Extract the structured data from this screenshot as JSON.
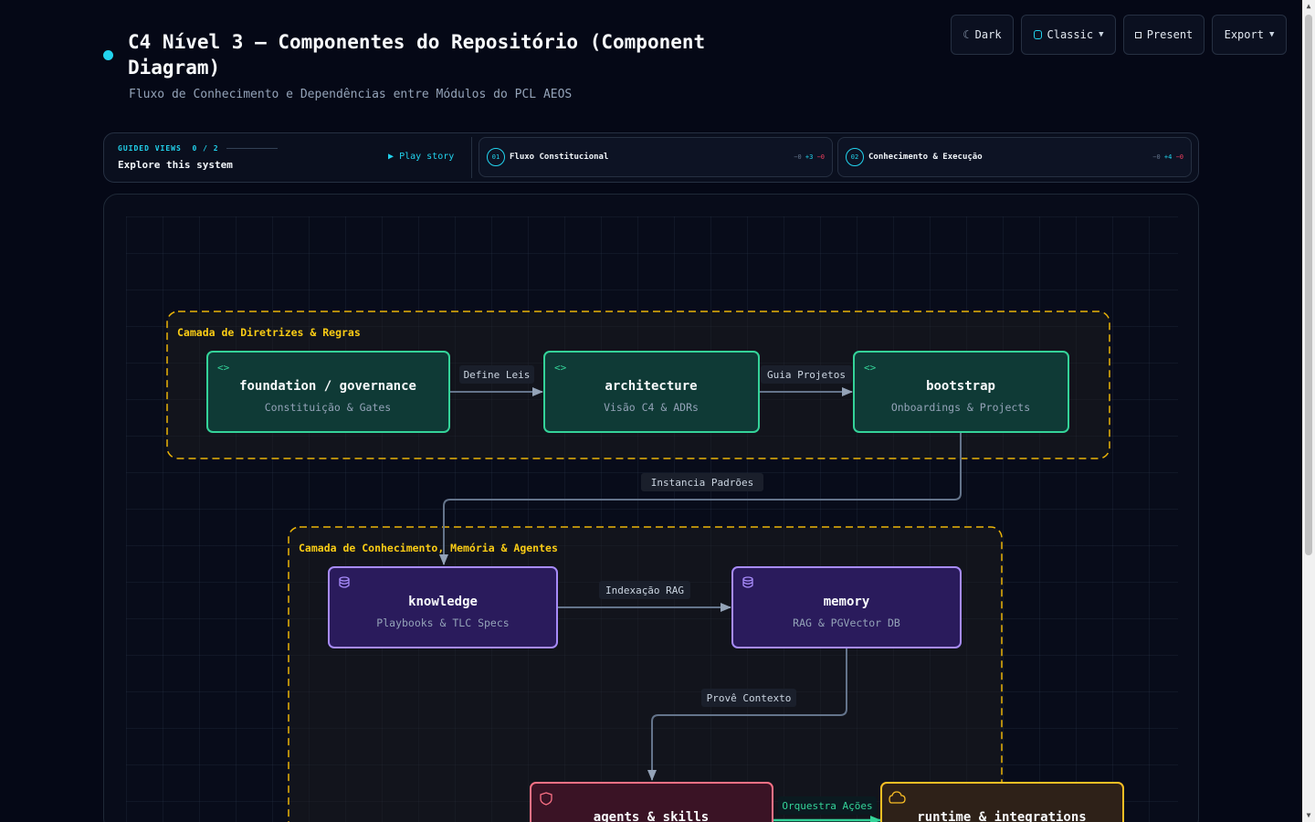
{
  "header": {
    "title": "C4 Nível 3 — Componentes do Repositório (Component Diagram)",
    "subtitle": "Fluxo de Conhecimento e Dependências entre Módulos do PCL AEOS"
  },
  "toolbar": {
    "theme_label": "Dark",
    "style_label": "Classic",
    "present_label": "Present",
    "export_label": "Export"
  },
  "guided": {
    "label": "GUIDED VIEWS",
    "progress": "0 / 2",
    "explore": "Explore this system",
    "play": "Play story",
    "stories": [
      {
        "num": "01",
        "label": "Fluxo Constitucional",
        "zero": "−0",
        "plus": "+3",
        "minus": "−0"
      },
      {
        "num": "02",
        "label": "Conhecimento & Execução",
        "zero": "−0",
        "plus": "+4",
        "minus": "−0"
      }
    ]
  },
  "groups": {
    "rules": "Camada de Diretrizes & Regras",
    "knowledge": "Camada de Conhecimento, Memória & Agentes"
  },
  "nodes": {
    "foundation": {
      "title": "foundation / governance",
      "sub": "Constituição & Gates",
      "icon": "code-icon"
    },
    "architecture": {
      "title": "architecture",
      "sub": "Visão C4 & ADRs",
      "icon": "code-icon"
    },
    "bootstrap": {
      "title": "bootstrap",
      "sub": "Onboardings & Projects",
      "icon": "code-icon"
    },
    "knowledge": {
      "title": "knowledge",
      "sub": "Playbooks & TLC Specs",
      "icon": "database-icon"
    },
    "memory": {
      "title": "memory",
      "sub": "RAG & PGVector DB",
      "icon": "database-icon"
    },
    "agents": {
      "title": "agents & skills",
      "sub": "",
      "icon": "shield-icon"
    },
    "runtime": {
      "title": "runtime & integrations",
      "sub": "",
      "icon": "cloud-icon"
    }
  },
  "edges": {
    "define_leis": "Define Leis",
    "guia_projetos": "Guia Projetos",
    "instancia": "Instancia Padrões",
    "indexacao": "Indexação RAG",
    "prove": "Provê Contexto",
    "orquestra": "Orquestra Ações"
  },
  "colors": {
    "teal_fill": "#0f3a36",
    "teal_stroke": "#34d399",
    "purple_fill": "#2a1b5c",
    "purple_stroke": "#a78bfa",
    "pink_fill": "#3a1325",
    "pink_stroke": "#fb7185",
    "amber_fill": "#2e2118",
    "amber_stroke": "#fbbf24",
    "group_stroke": "#eab308",
    "edge": "#64748b",
    "accent": "#22d3ee"
  }
}
